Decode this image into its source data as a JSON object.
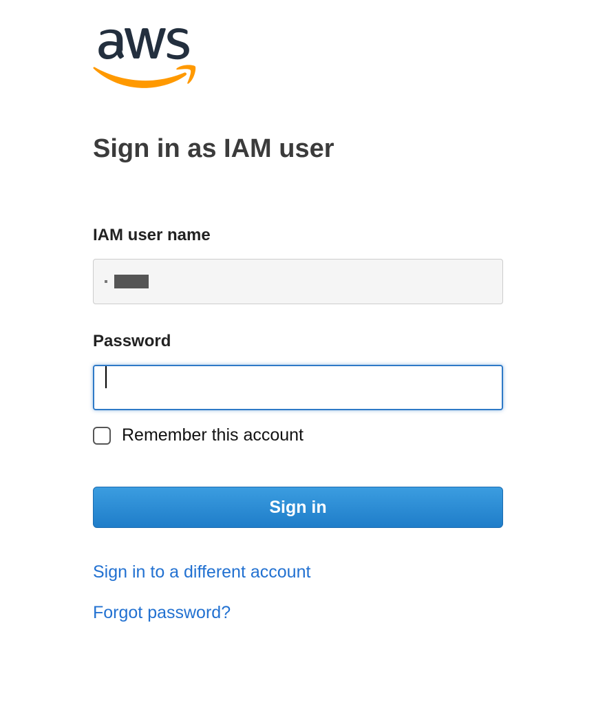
{
  "logo": {
    "brand": "aws"
  },
  "heading": "Sign in as IAM user",
  "form": {
    "username": {
      "label": "IAM user name",
      "value_redacted": true
    },
    "password": {
      "label": "Password",
      "value": "",
      "focused": true
    },
    "remember": {
      "label": "Remember this account",
      "checked": false
    },
    "submit": {
      "label": "Sign in"
    }
  },
  "links": {
    "different_account": "Sign in to a different account",
    "forgot_password": "Forgot password?"
  },
  "colors": {
    "accent_blue": "#2271d1",
    "button_blue_top": "#3b9de0",
    "button_blue_bottom": "#1f7dc9",
    "aws_orange": "#FF9900",
    "aws_navy": "#232F3E"
  }
}
